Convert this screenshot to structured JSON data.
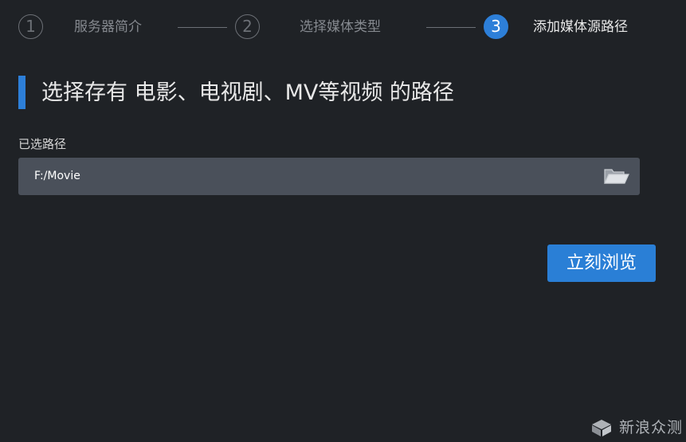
{
  "stepper": {
    "steps": [
      {
        "number": "1",
        "label": "服务器简介",
        "state": "inactive"
      },
      {
        "number": "2",
        "label": "选择媒体类型",
        "state": "inactive"
      },
      {
        "number": "3",
        "label": "添加媒体源路径",
        "state": "active"
      }
    ]
  },
  "main": {
    "heading": "选择存有 电影、电视剧、MV等视频 的路径",
    "field_label": "已选路径",
    "selected_path": "F:/Movie",
    "browse_button_label": "立刻浏览"
  },
  "watermark": {
    "text": "新浪众测"
  },
  "colors": {
    "background": "#1f2226",
    "accent": "#2d7fd8",
    "input_background": "#4a505a",
    "inactive_step": "#6c7076"
  },
  "icons": {
    "folder": "folder-open-icon",
    "watermark_logo": "cube-logo-icon"
  }
}
